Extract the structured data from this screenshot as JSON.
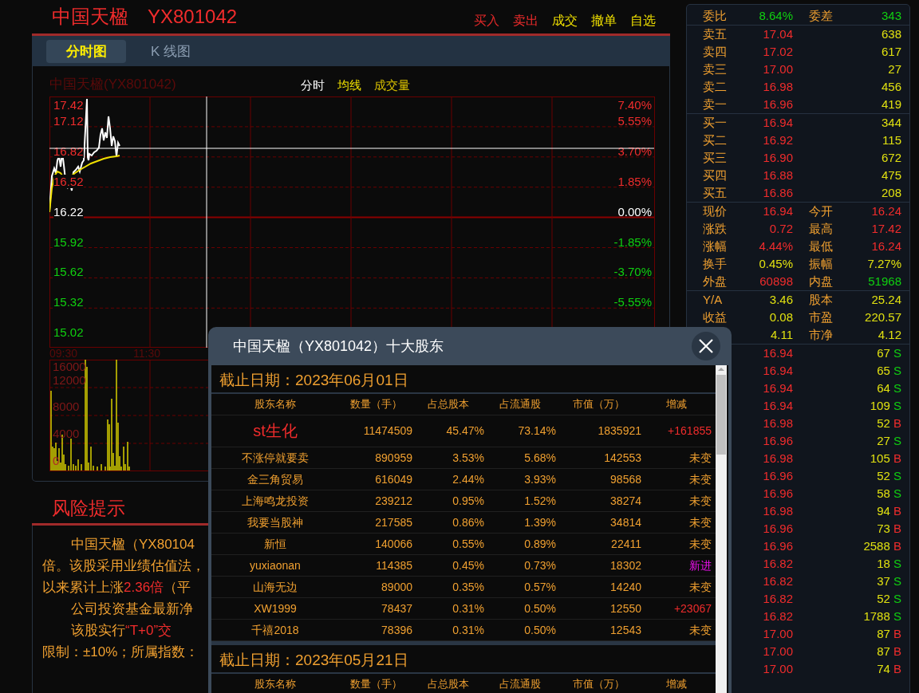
{
  "header": {
    "name": "中国天楹",
    "code": "YX801042",
    "actions": [
      {
        "label": "买入",
        "color": "#e02828"
      },
      {
        "label": "卖出",
        "color": "#f02c2c"
      },
      {
        "label": "成交",
        "color": "#f0e000"
      },
      {
        "label": "撤单",
        "color": "#f0e000"
      },
      {
        "label": "自选",
        "color": "#f0e000"
      }
    ]
  },
  "tabs": [
    {
      "label": "分时图",
      "selected": true
    },
    {
      "label": "K 线图",
      "selected": false
    }
  ],
  "chart": {
    "title": "中国天楹(YX801042)",
    "legend": [
      {
        "label": "分时",
        "kind": "price"
      },
      {
        "label": "均线",
        "kind": "average"
      },
      {
        "label": "成交量",
        "kind": "volume"
      }
    ],
    "price_ticks": [
      {
        "label": "17.42",
        "color": "#f02c2c"
      },
      {
        "label": "17.12",
        "color": "#f02c2c"
      },
      {
        "label": "16.82",
        "color": "#f02c2c"
      },
      {
        "label": "16.52",
        "color": "#f02c2c"
      },
      {
        "label": "16.22",
        "color": "#ffffff"
      },
      {
        "label": "15.92",
        "color": "#10d010"
      },
      {
        "label": "15.62",
        "color": "#10d010"
      },
      {
        "label": "15.32",
        "color": "#10d010"
      },
      {
        "label": "15.02",
        "color": "#10d010"
      }
    ],
    "percent_ticks": [
      {
        "label": "7.40%",
        "color": "#f02c2c"
      },
      {
        "label": "5.55%",
        "color": "#f02c2c"
      },
      {
        "label": "3.70%",
        "color": "#f02c2c"
      },
      {
        "label": "1.85%",
        "color": "#f02c2c"
      },
      {
        "label": "0.00%",
        "color": "#ffffff"
      },
      {
        "label": "-1.85%",
        "color": "#10d010"
      },
      {
        "label": "-3.70%",
        "color": "#10d010"
      },
      {
        "label": "-5.55%",
        "color": "#10d010"
      }
    ],
    "time_labels": [
      "09:30",
      "11:30"
    ],
    "volume_ticks": [
      "16000",
      "12000",
      "8000",
      "4000",
      "0"
    ]
  },
  "risk": {
    "title": "风险提示",
    "lines": [
      {
        "indent": true,
        "parts": [
          {
            "text": "中国天楹（YX80104",
            "color": "#f0a030"
          }
        ]
      },
      {
        "indent": false,
        "parts": [
          {
            "text": "倍。该股采用业绩估值法，",
            "color": "#f0a030"
          }
        ]
      },
      {
        "indent": false,
        "parts": [
          {
            "text": "以来累计上涨",
            "color": "#f0a030"
          },
          {
            "text": "2.36倍",
            "color": "#f02c2c"
          },
          {
            "text": "（平",
            "color": "#f0a030"
          }
        ]
      },
      {
        "indent": true,
        "parts": [
          {
            "text": "公司投资基金最新净",
            "color": "#f0a030"
          }
        ]
      },
      {
        "indent": true,
        "parts": [
          {
            "text": "该股实行",
            "color": "#f0a030"
          },
          {
            "text": "“T+0”交",
            "color": "#f02c2c"
          }
        ]
      },
      {
        "indent": false,
        "parts": [
          {
            "text": "限制：±10%；所属指数：",
            "color": "#f0a030"
          }
        ]
      }
    ]
  },
  "quote_panel": {
    "sections": [
      [
        {
          "label": "委比",
          "value": "8.64%",
          "color": "#10d010",
          "second": {
            "label": "委差",
            "value": "343",
            "color": "#10d010"
          }
        }
      ],
      [
        {
          "label": "卖五",
          "value": "17.04",
          "color": "#f02c2c",
          "second": {
            "value": "638",
            "color": "#e0e010"
          }
        },
        {
          "label": "卖四",
          "value": "17.02",
          "color": "#f02c2c",
          "second": {
            "value": "617",
            "color": "#e0e010"
          }
        },
        {
          "label": "卖三",
          "value": "17.00",
          "color": "#f02c2c",
          "second": {
            "value": "27",
            "color": "#e0e010"
          }
        },
        {
          "label": "卖二",
          "value": "16.98",
          "color": "#f02c2c",
          "second": {
            "value": "456",
            "color": "#e0e010"
          }
        },
        {
          "label": "卖一",
          "value": "16.96",
          "color": "#f02c2c",
          "second": {
            "value": "419",
            "color": "#e0e010"
          }
        }
      ],
      [
        {
          "label": "买一",
          "value": "16.94",
          "color": "#f02c2c",
          "second": {
            "value": "344",
            "color": "#e0e010"
          }
        },
        {
          "label": "买二",
          "value": "16.92",
          "color": "#f02c2c",
          "second": {
            "value": "115",
            "color": "#e0e010"
          }
        },
        {
          "label": "买三",
          "value": "16.90",
          "color": "#f02c2c",
          "second": {
            "value": "672",
            "color": "#e0e010"
          }
        },
        {
          "label": "买四",
          "value": "16.88",
          "color": "#f02c2c",
          "second": {
            "value": "475",
            "color": "#e0e010"
          }
        },
        {
          "label": "买五",
          "value": "16.86",
          "color": "#f02c2c",
          "second": {
            "value": "208",
            "color": "#e0e010"
          }
        }
      ],
      [
        {
          "label": "现价",
          "value": "16.94",
          "color": "#f02c2c",
          "second": {
            "label": "今开",
            "value": "16.24",
            "color": "#f02c2c"
          }
        },
        {
          "label": "涨跌",
          "value": "0.72",
          "color": "#f02c2c",
          "second": {
            "label": "最高",
            "value": "17.42",
            "color": "#f02c2c"
          }
        },
        {
          "label": "涨幅",
          "value": "4.44%",
          "color": "#f02c2c",
          "second": {
            "label": "最低",
            "value": "16.24",
            "color": "#f02c2c"
          }
        },
        {
          "label": "换手",
          "value": "0.45%",
          "color": "#e0e010",
          "second": {
            "label": "振幅",
            "value": "7.27%",
            "color": "#e0e010"
          }
        },
        {
          "label": "外盘",
          "value": "60898",
          "color": "#f02c2c",
          "second": {
            "label": "内盘",
            "value": "51968",
            "color": "#10d010"
          }
        }
      ],
      [
        {
          "label": "Y/A",
          "value": "3.46",
          "color": "#e0e010",
          "second": {
            "label": "股本",
            "value": "25.24",
            "color": "#e0e010"
          }
        },
        {
          "label": "收益",
          "value": "0.08",
          "color": "#e0e010",
          "second": {
            "label": "市盈",
            "value": "220.57",
            "color": "#e0e010"
          }
        },
        {
          "value": "4.11",
          "color": "#e0e010",
          "second": {
            "label": "市净",
            "value": "4.12",
            "color": "#e0e010"
          }
        }
      ]
    ],
    "trades": [
      {
        "price": "16.94",
        "volume": "67",
        "side": "S",
        "color": "#10d010"
      },
      {
        "price": "16.94",
        "volume": "65",
        "side": "S",
        "color": "#10d010"
      },
      {
        "price": "16.94",
        "volume": "64",
        "side": "S",
        "color": "#10d010"
      },
      {
        "price": "16.94",
        "volume": "109",
        "side": "S",
        "color": "#10d010"
      },
      {
        "price": "16.98",
        "volume": "52",
        "side": "B",
        "color": "#f02c2c"
      },
      {
        "price": "16.96",
        "volume": "27",
        "side": "S",
        "color": "#10d010"
      },
      {
        "price": "16.98",
        "volume": "105",
        "side": "B",
        "color": "#f02c2c"
      },
      {
        "price": "16.96",
        "volume": "52",
        "side": "S",
        "color": "#10d010"
      },
      {
        "price": "16.96",
        "volume": "58",
        "side": "S",
        "color": "#10d010"
      },
      {
        "price": "16.98",
        "volume": "94",
        "side": "B",
        "color": "#f02c2c"
      },
      {
        "price": "16.96",
        "volume": "73",
        "side": "B",
        "color": "#f02c2c"
      },
      {
        "price": "16.96",
        "volume": "2588",
        "side": "B",
        "color": "#f02c2c"
      },
      {
        "price": "16.82",
        "volume": "18",
        "side": "S",
        "color": "#10d010"
      },
      {
        "price": "16.82",
        "volume": "37",
        "side": "S",
        "color": "#10d010"
      },
      {
        "price": "16.82",
        "volume": "52",
        "side": "S",
        "color": "#10d010"
      },
      {
        "price": "16.82",
        "volume": "1788",
        "side": "S",
        "color": "#10d010"
      },
      {
        "price": "17.00",
        "volume": "87",
        "side": "B",
        "color": "#f02c2c"
      },
      {
        "price": "17.00",
        "volume": "87",
        "side": "B",
        "color": "#f02c2c"
      },
      {
        "price": "17.00",
        "volume": "74",
        "side": "B",
        "color": "#f02c2c"
      }
    ]
  },
  "dialog": {
    "title": "中国天楹（YX801042）十大股东",
    "sections": [
      {
        "date": "截止日期：2023年06月01日",
        "columns": [
          "股东名称",
          "数量（手）",
          "占总股本",
          "占流通股",
          "市值（万）",
          "增减"
        ],
        "rows": [
          {
            "name": "st生化",
            "shares": "11474509",
            "total_pct": "45.47%",
            "float_pct": "73.14%",
            "value": "1835921",
            "change": "+161855",
            "color": "#f02c2c",
            "major": true
          },
          {
            "name": "不涨停就要卖",
            "shares": "890959",
            "total_pct": "3.53%",
            "float_pct": "5.68%",
            "value": "142553",
            "change": "未变",
            "color": "#f0a030",
            "major": false
          },
          {
            "name": "金三角贸易",
            "shares": "616049",
            "total_pct": "2.44%",
            "float_pct": "3.93%",
            "value": "98568",
            "change": "未变",
            "color": "#f0a030",
            "major": false
          },
          {
            "name": "上海鸣龙投资",
            "shares": "239212",
            "total_pct": "0.95%",
            "float_pct": "1.52%",
            "value": "38274",
            "change": "未变",
            "color": "#f0a030",
            "major": false
          },
          {
            "name": "我要当股神",
            "shares": "217585",
            "total_pct": "0.86%",
            "float_pct": "1.39%",
            "value": "34814",
            "change": "未变",
            "color": "#f0a030",
            "major": false
          },
          {
            "name": "新恒",
            "shares": "140066",
            "total_pct": "0.55%",
            "float_pct": "0.89%",
            "value": "22411",
            "change": "未变",
            "color": "#f0a030",
            "major": false
          },
          {
            "name": "yuxiaonan",
            "shares": "114385",
            "total_pct": "0.45%",
            "float_pct": "0.73%",
            "value": "18302",
            "change": "新进",
            "color": "#f010f0",
            "major": false
          },
          {
            "name": "山海无边",
            "shares": "89000",
            "total_pct": "0.35%",
            "float_pct": "0.57%",
            "value": "14240",
            "change": "未变",
            "color": "#f0a030",
            "major": false
          },
          {
            "name": "XW1999",
            "shares": "78437",
            "total_pct": "0.31%",
            "float_pct": "0.50%",
            "value": "12550",
            "change": "+23067",
            "color": "#f02c2c",
            "major": false
          },
          {
            "name": "千禧2018",
            "shares": "78396",
            "total_pct": "0.31%",
            "float_pct": "0.50%",
            "value": "12543",
            "change": "未变",
            "color": "#f0a030",
            "major": false
          }
        ]
      },
      {
        "date": "截止日期：2023年05月21日",
        "columns": [
          "股东名称",
          "数量（手）",
          "占总股本",
          "占流通股",
          "市值（万）",
          "增减"
        ]
      }
    ]
  }
}
